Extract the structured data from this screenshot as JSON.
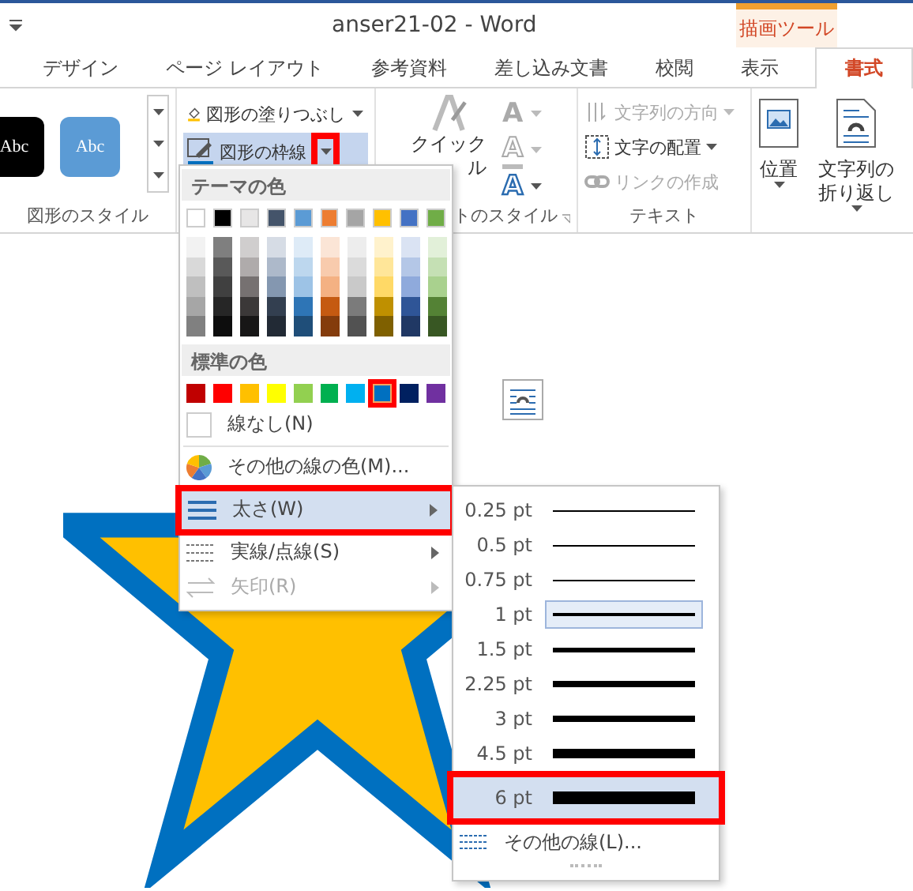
{
  "window": {
    "title": "anser21-02 - Word",
    "context_title": "描画ツール"
  },
  "tabs": [
    {
      "label": "デザイン",
      "selected": false
    },
    {
      "label": "ページ レイアウト",
      "selected": false
    },
    {
      "label": "参考資料",
      "selected": false
    },
    {
      "label": "差し込み文書",
      "selected": false
    },
    {
      "label": "校閲",
      "selected": false
    },
    {
      "label": "表示",
      "selected": false
    },
    {
      "label": "書式",
      "selected": true
    }
  ],
  "ribbon": {
    "shape_styles": {
      "presets": [
        {
          "label": "Abc",
          "color": "#000000"
        },
        {
          "label": "Abc",
          "color": "#5b9bd5"
        }
      ],
      "label": "図形のスタイル"
    },
    "shape_commands": [
      {
        "label": "図形の塗りつぶし",
        "kind": "fill",
        "active": false,
        "marked": false
      },
      {
        "label": "図形の枠線",
        "kind": "outline",
        "active": true,
        "marked": true
      }
    ],
    "wordart": {
      "button": "クイック",
      "button_rest": "ル",
      "label": "トのスタイル",
      "glyphs": [
        {
          "glyph": "A",
          "kind": "fill"
        },
        {
          "glyph": "A",
          "kind": "outline"
        },
        {
          "glyph": "A",
          "kind": "effects"
        }
      ]
    },
    "text_group": {
      "items": [
        {
          "label": "文字列の方向",
          "kind": "direction",
          "disabled": true
        },
        {
          "label": "文字の配置",
          "kind": "align",
          "disabled": false
        },
        {
          "label": "リンクの作成",
          "kind": "link",
          "disabled": true
        }
      ],
      "label": "テキスト"
    },
    "arrange": [
      {
        "lines": [
          "位置"
        ],
        "kind": "position"
      },
      {
        "lines": [
          "文字列の",
          "折り返し"
        ],
        "kind": "wrap"
      }
    ]
  },
  "outline_menu": {
    "theme_heading": "テーマの色",
    "theme_colors": [
      {
        "color": "#ffffff",
        "shades": [
          {
            "color": "#f2f2f2"
          },
          {
            "color": "#d9d9d9"
          },
          {
            "color": "#bfbfbf"
          },
          {
            "color": "#a6a6a6"
          },
          {
            "color": "#808080"
          }
        ]
      },
      {
        "color": "#000000",
        "shades": [
          {
            "color": "#7f7f7f"
          },
          {
            "color": "#595959"
          },
          {
            "color": "#404040"
          },
          {
            "color": "#262626"
          },
          {
            "color": "#0d0d0d"
          }
        ]
      },
      {
        "color": "#e7e6e6",
        "shades": [
          {
            "color": "#d0cece"
          },
          {
            "color": "#afabab"
          },
          {
            "color": "#767171"
          },
          {
            "color": "#3b3838"
          },
          {
            "color": "#171616"
          }
        ]
      },
      {
        "color": "#44546a",
        "shades": [
          {
            "color": "#d6dce5"
          },
          {
            "color": "#adb9ca"
          },
          {
            "color": "#8497b0"
          },
          {
            "color": "#333f50"
          },
          {
            "color": "#222a35"
          }
        ]
      },
      {
        "color": "#5b9bd5",
        "shades": [
          {
            "color": "#deebf7"
          },
          {
            "color": "#bdd7ee"
          },
          {
            "color": "#9dc3e6"
          },
          {
            "color": "#2e75b6"
          },
          {
            "color": "#1f4e79"
          }
        ]
      },
      {
        "color": "#ed7d31",
        "shades": [
          {
            "color": "#fbe5d6"
          },
          {
            "color": "#f8cbad"
          },
          {
            "color": "#f4b183"
          },
          {
            "color": "#c55a11"
          },
          {
            "color": "#843c0c"
          }
        ]
      },
      {
        "color": "#a5a5a5",
        "shades": [
          {
            "color": "#ededed"
          },
          {
            "color": "#dbdbdb"
          },
          {
            "color": "#c9c9c9"
          },
          {
            "color": "#7b7b7b"
          },
          {
            "color": "#525252"
          }
        ]
      },
      {
        "color": "#ffc000",
        "shades": [
          {
            "color": "#fff2cc"
          },
          {
            "color": "#ffe699"
          },
          {
            "color": "#ffd966"
          },
          {
            "color": "#bf9000"
          },
          {
            "color": "#7f6000"
          }
        ]
      },
      {
        "color": "#4472c4",
        "shades": [
          {
            "color": "#dae3f3"
          },
          {
            "color": "#b4c7e7"
          },
          {
            "color": "#8faadc"
          },
          {
            "color": "#2f5597"
          },
          {
            "color": "#203864"
          }
        ]
      },
      {
        "color": "#70ad47",
        "shades": [
          {
            "color": "#e2f0d9"
          },
          {
            "color": "#c5e0b4"
          },
          {
            "color": "#a9d18e"
          },
          {
            "color": "#548235"
          },
          {
            "color": "#385723"
          }
        ]
      }
    ],
    "standard_heading": "標準の色",
    "standard_colors": [
      {
        "color": "#c00000",
        "selected": false
      },
      {
        "color": "#ff0000",
        "selected": false
      },
      {
        "color": "#ffc000",
        "selected": false
      },
      {
        "color": "#ffff00",
        "selected": false
      },
      {
        "color": "#92d050",
        "selected": false
      },
      {
        "color": "#00b050",
        "selected": false
      },
      {
        "color": "#00b0f0",
        "selected": false
      },
      {
        "color": "#0070c0",
        "selected": true
      },
      {
        "color": "#002060",
        "selected": false
      },
      {
        "color": "#7030a0",
        "selected": false
      }
    ],
    "items": [
      {
        "label": "線なし(N)",
        "kind": "none",
        "highlighted": false,
        "disabled": false,
        "submenu": false
      },
      {
        "label": "その他の線の色(M)...",
        "kind": "palette",
        "highlighted": false,
        "disabled": false,
        "submenu": false
      },
      {
        "label": "太さ(W)",
        "kind": "weight",
        "highlighted": true,
        "disabled": false,
        "submenu": true
      },
      {
        "label": "実線/点線(S)",
        "kind": "dash",
        "highlighted": false,
        "disabled": false,
        "submenu": true
      },
      {
        "label": "矢印(R)",
        "kind": "arrow",
        "highlighted": false,
        "disabled": true,
        "submenu": true
      }
    ]
  },
  "weight_menu": {
    "items": [
      {
        "label": "0.25 pt",
        "selected": false,
        "highlighted": false
      },
      {
        "label": "0.5 pt",
        "selected": false,
        "highlighted": false
      },
      {
        "label": "0.75 pt",
        "selected": false,
        "highlighted": false
      },
      {
        "label": "1 pt",
        "selected": true,
        "highlighted": false
      },
      {
        "label": "1.5 pt",
        "selected": false,
        "highlighted": false
      },
      {
        "label": "2.25 pt",
        "selected": false,
        "highlighted": false
      },
      {
        "label": "3 pt",
        "selected": false,
        "highlighted": false
      },
      {
        "label": "4.5 pt",
        "selected": false,
        "highlighted": false
      },
      {
        "label": "6 pt",
        "selected": false,
        "highlighted": true
      }
    ],
    "more": "その他の線(L)..."
  }
}
